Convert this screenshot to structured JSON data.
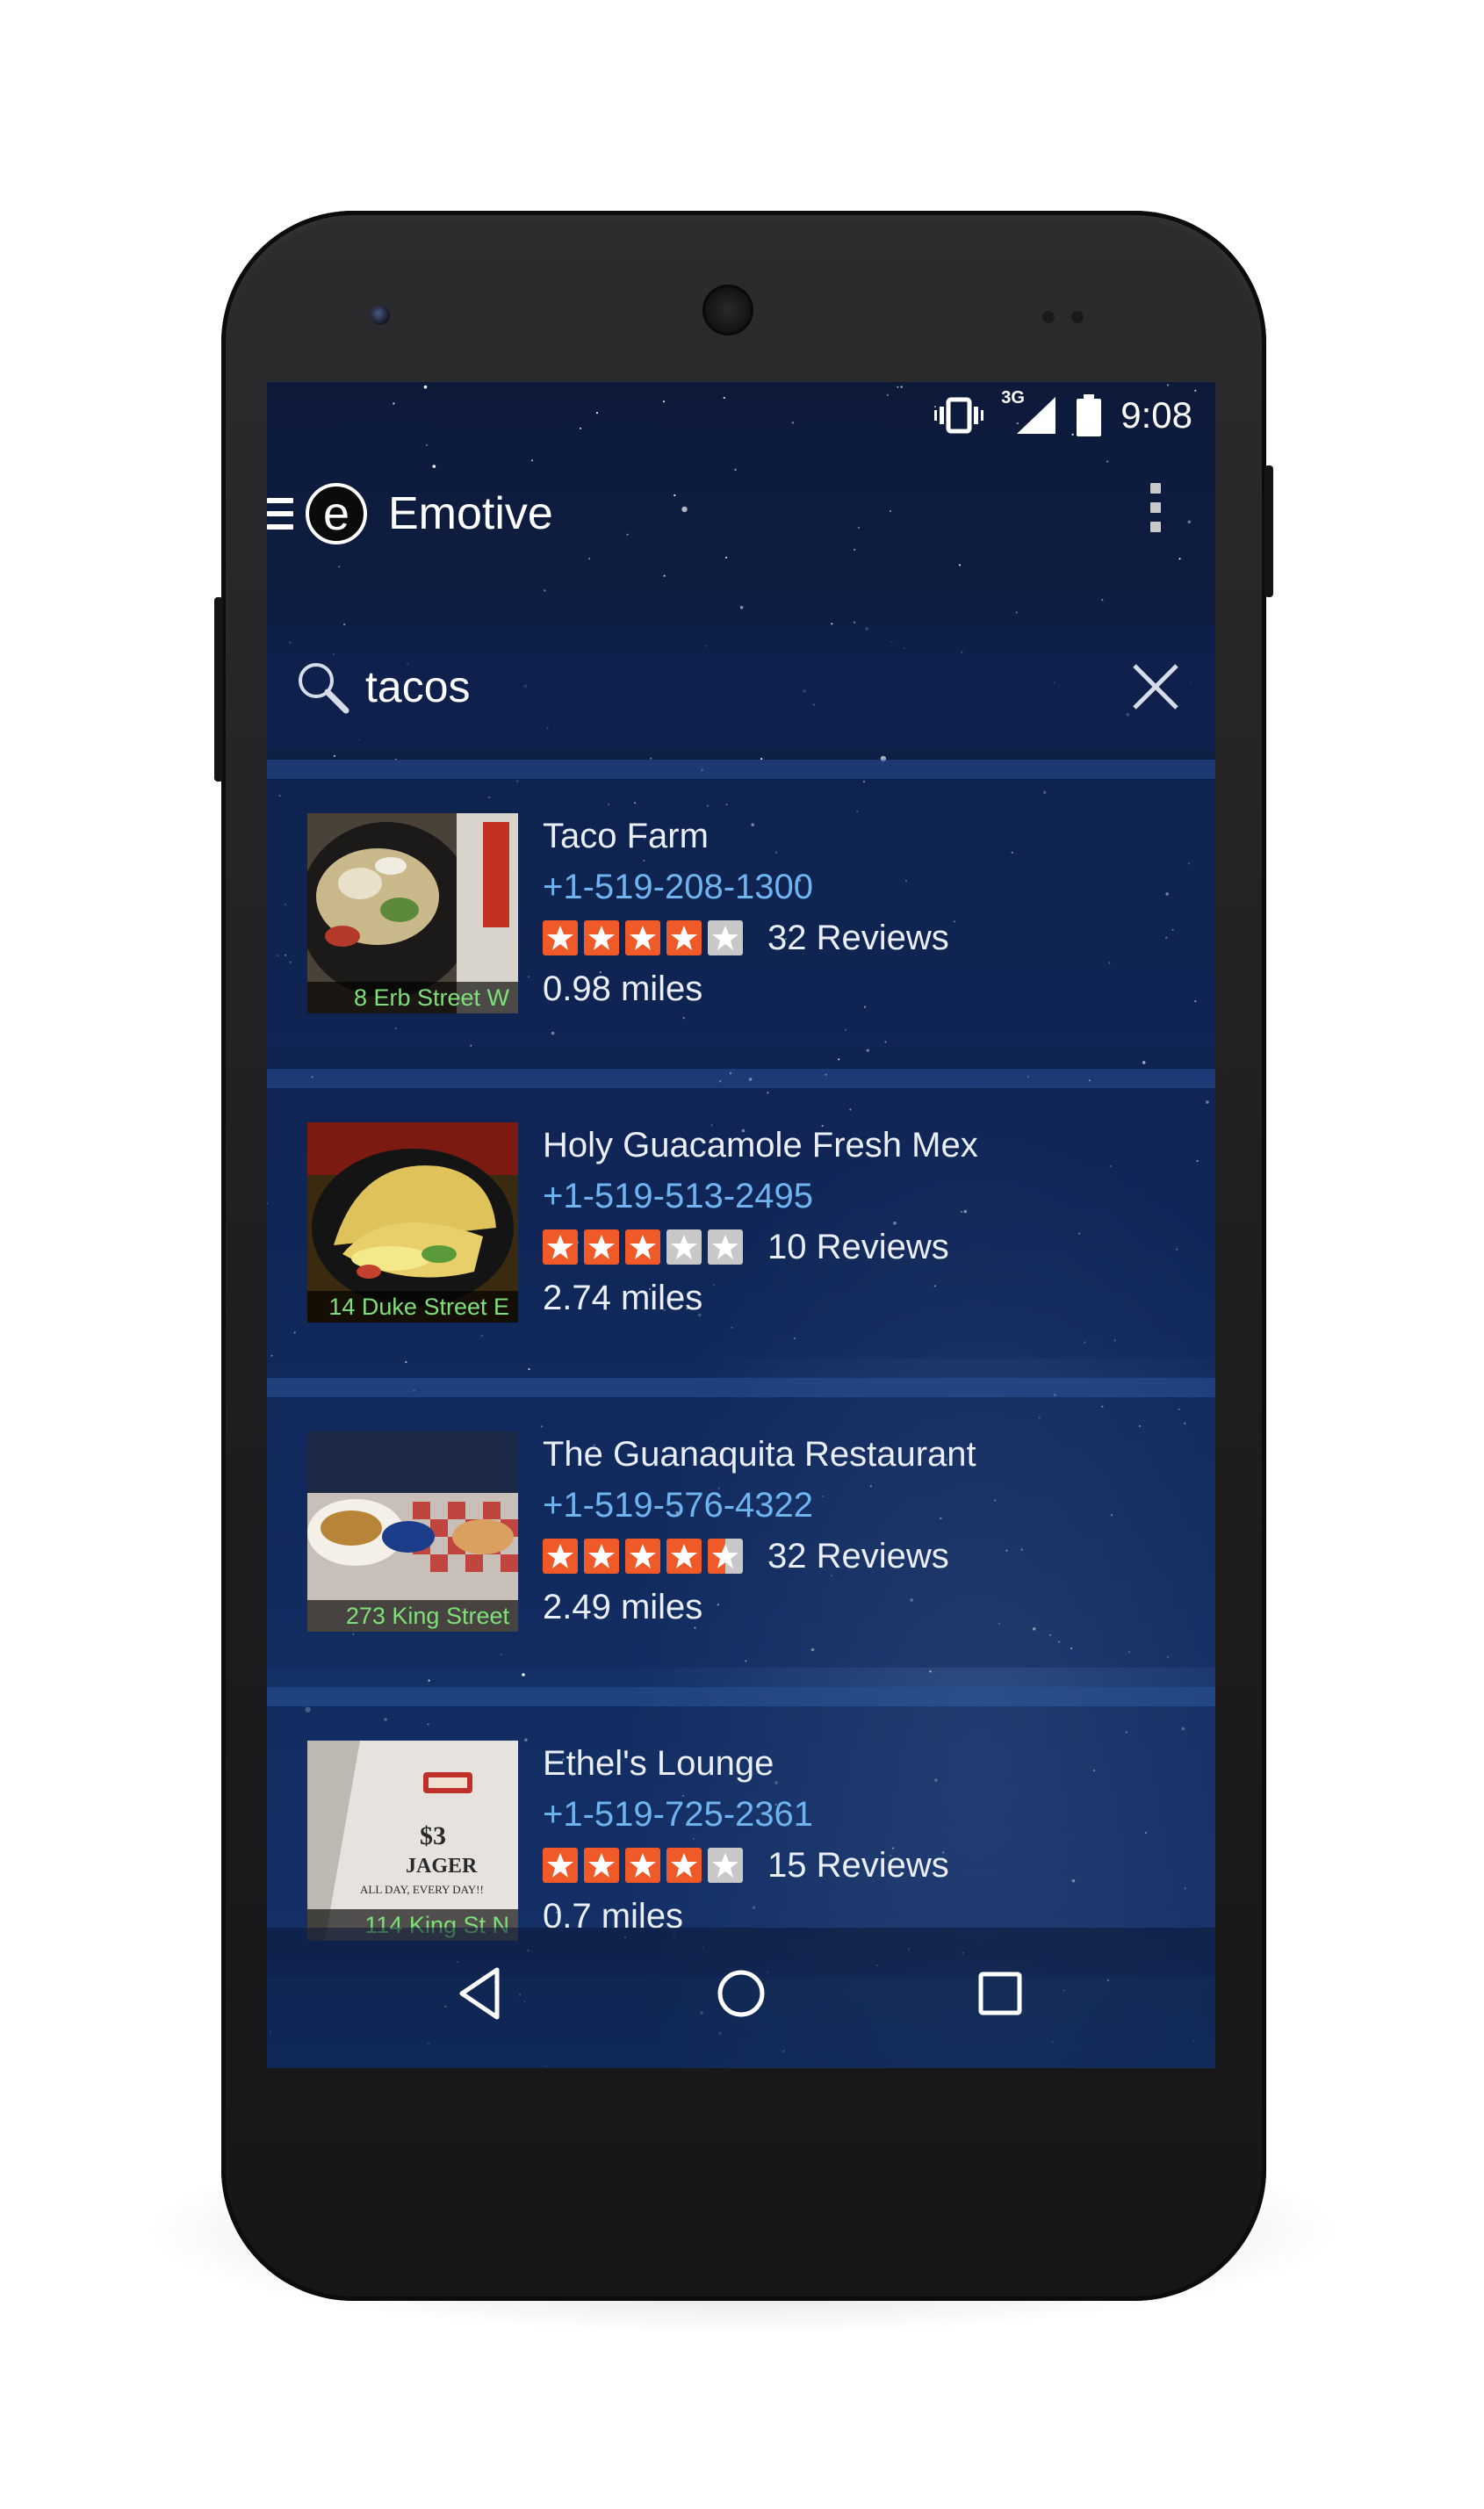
{
  "status_bar": {
    "network": "3G",
    "time": "9:08",
    "icons": [
      "vibrate-icon",
      "signal-icon",
      "battery-icon"
    ]
  },
  "app_bar": {
    "title": "Emotive",
    "logo_letter": "e",
    "icons": [
      "menu-icon",
      "overflow-menu-icon"
    ]
  },
  "search": {
    "query": "tacos",
    "icons": [
      "search-icon",
      "clear-icon"
    ]
  },
  "colors": {
    "star_filled": "#f05a28",
    "star_empty": "#c8c8c8",
    "phone_link": "#6fb3ef",
    "address_label": "#7fe07a"
  },
  "results": [
    {
      "name": "Taco Farm",
      "phone": "+1-519-208-1300",
      "rating": 4,
      "max_rating": 5,
      "reviews": "32 Reviews",
      "distance": "0.98 miles",
      "address": "8 Erb Street W"
    },
    {
      "name": "Holy Guacamole Fresh Mex",
      "phone": "+1-519-513-2495",
      "rating": 3,
      "max_rating": 5,
      "reviews": "10 Reviews",
      "distance": "2.74 miles",
      "address": "14 Duke Street E"
    },
    {
      "name": "The Guanaquita Restaurant",
      "phone": "+1-519-576-4322",
      "rating": 4.5,
      "max_rating": 5,
      "reviews": "32 Reviews",
      "distance": "2.49 miles",
      "address": "273 King Street"
    },
    {
      "name": "Ethel's Lounge",
      "phone": "+1-519-725-2361",
      "rating": 4,
      "max_rating": 5,
      "reviews": "15 Reviews",
      "distance": "0.7 miles",
      "address": "114 King St N",
      "photo_text": [
        "$3",
        "JAGER",
        "ALL DAY, EVERY DAY!!"
      ]
    }
  ],
  "nav_bar": {
    "icons": [
      "back-icon",
      "home-icon",
      "recents-icon"
    ]
  }
}
